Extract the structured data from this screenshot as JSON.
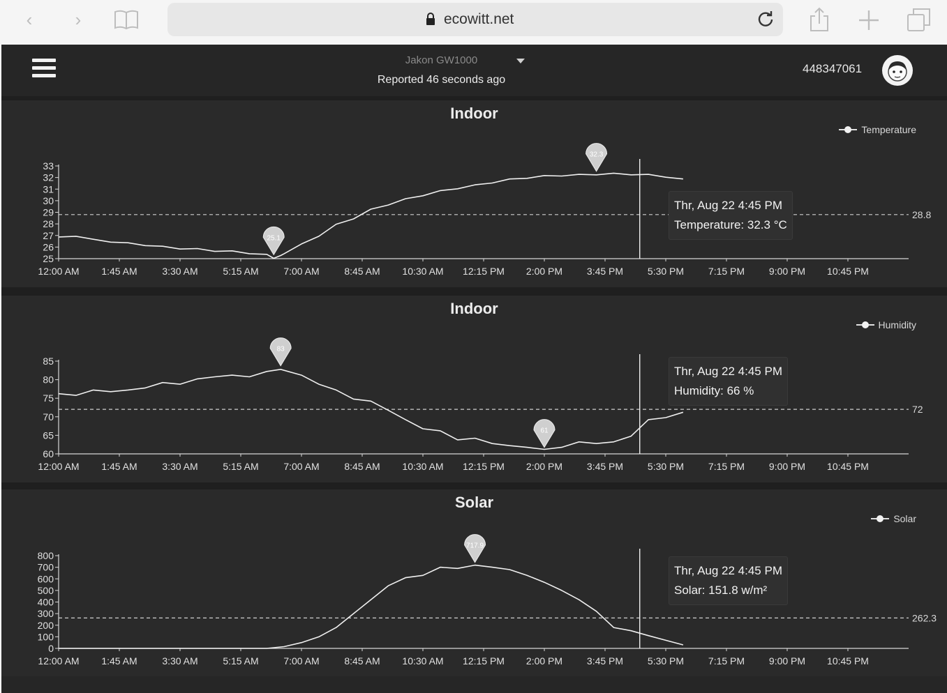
{
  "browser": {
    "url": "ecowitt.net"
  },
  "header": {
    "device": "Jakon GW1000",
    "reported": "Reported 46 seconds ago",
    "user_id": "448347061"
  },
  "charts": [
    {
      "title": "Indoor",
      "legend": "Temperature",
      "avg_label": "28.8",
      "tooltip_time": "Thr, Aug 22 4:45 PM",
      "tooltip_value": "Temperature: 32.3 °C",
      "ymin_label": "25.1",
      "ymax_label": "32.3"
    },
    {
      "title": "Indoor",
      "legend": "Humidity",
      "avg_label": "72",
      "tooltip_time": "Thr, Aug 22 4:45 PM",
      "tooltip_value": "Humidity: 66 %",
      "ymin_label": "61",
      "ymax_label": "83"
    },
    {
      "title": "Solar",
      "legend": "Solar",
      "avg_label": "262.3",
      "tooltip_time": "Thr, Aug 22 4:45 PM",
      "tooltip_value": "Solar: 151.8 w/m²",
      "ymax_label": "717.9"
    }
  ],
  "chart_data": [
    {
      "type": "line",
      "title": "Indoor",
      "legend": "Temperature",
      "x_ticks": [
        "12:00 AM",
        "1:45 AM",
        "3:30 AM",
        "5:15 AM",
        "7:00 AM",
        "8:45 AM",
        "10:30 AM",
        "12:15 PM",
        "2:00 PM",
        "3:45 PM",
        "5:30 PM",
        "7:15 PM",
        "9:00 PM",
        "10:45 PM"
      ],
      "y_ticks": [
        25,
        26,
        27,
        28,
        29,
        30,
        31,
        32,
        33
      ],
      "ylim": [
        25,
        33
      ],
      "xlim_hours": [
        0,
        24.5
      ],
      "average": 28.8,
      "marker_x_hours": 16.75,
      "x_hours": [
        0,
        0.5,
        1,
        1.5,
        2,
        2.5,
        3,
        3.5,
        4,
        4.5,
        5,
        5.5,
        6,
        6.2,
        6.4,
        6.5,
        7,
        7.5,
        8,
        8.5,
        9,
        9.5,
        10,
        10.5,
        11,
        11.5,
        12,
        12.5,
        13,
        13.5,
        14,
        14.5,
        15,
        15.5,
        16,
        16.5,
        17,
        17.5,
        18
      ],
      "y_values": [
        26.8,
        27,
        26.6,
        26.5,
        26.3,
        26.2,
        26,
        25.9,
        25.8,
        25.7,
        25.6,
        25.5,
        25.3,
        25.1,
        25.2,
        25.5,
        26.2,
        27,
        27.9,
        28.5,
        29.2,
        29.7,
        30.1,
        30.5,
        30.8,
        31.1,
        31.3,
        31.6,
        31.8,
        32,
        32.1,
        32.2,
        32.2,
        32.3,
        32.3,
        32.3,
        32.2,
        32.1,
        31.8
      ]
    },
    {
      "type": "line",
      "title": "Indoor",
      "legend": "Humidity",
      "x_ticks": [
        "12:00 AM",
        "1:45 AM",
        "3:30 AM",
        "5:15 AM",
        "7:00 AM",
        "8:45 AM",
        "10:30 AM",
        "12:15 PM",
        "2:00 PM",
        "3:45 PM",
        "5:30 PM",
        "7:15 PM",
        "9:00 PM",
        "10:45 PM"
      ],
      "y_ticks": [
        60,
        65,
        70,
        75,
        80,
        85
      ],
      "ylim": [
        60,
        85
      ],
      "xlim_hours": [
        0,
        24.5
      ],
      "average": 72,
      "marker_x_hours": 16.75,
      "x_hours": [
        0,
        0.5,
        1,
        1.5,
        2,
        2.5,
        3,
        3.5,
        4,
        4.5,
        5,
        5.5,
        6,
        6.4,
        7,
        7.5,
        8,
        8.5,
        9,
        9.5,
        10,
        10.5,
        11,
        11.5,
        12,
        12.5,
        13,
        13.5,
        14,
        14.5,
        15,
        15.5,
        16,
        16.5,
        17,
        17.5,
        18
      ],
      "y_values": [
        76,
        76,
        77,
        77,
        77,
        78,
        79,
        79,
        80,
        81,
        81,
        81,
        82,
        83,
        81,
        79,
        77,
        75,
        74,
        72,
        69,
        67,
        66,
        64,
        64,
        63,
        62,
        62,
        61,
        62,
        63,
        63,
        63,
        65,
        69,
        70,
        71
      ]
    },
    {
      "type": "area",
      "title": "Solar",
      "legend": "Solar",
      "x_ticks": [
        "12:00 AM",
        "1:45 AM",
        "3:30 AM",
        "5:15 AM",
        "7:00 AM",
        "8:45 AM",
        "10:30 AM",
        "12:15 PM",
        "2:00 PM",
        "3:45 PM",
        "5:30 PM",
        "7:15 PM",
        "9:00 PM",
        "10:45 PM"
      ],
      "y_ticks": [
        0,
        100,
        200,
        300,
        400,
        500,
        600,
        700,
        800
      ],
      "ylim": [
        0,
        800
      ],
      "xlim_hours": [
        0,
        24.5
      ],
      "average": 262.3,
      "marker_x_hours": 16.75,
      "x_hours": [
        0,
        6,
        6.5,
        7,
        7.5,
        8,
        8.5,
        9,
        9.5,
        10,
        10.5,
        11,
        11.5,
        12,
        12.5,
        13,
        13.5,
        14,
        14.5,
        15,
        15.5,
        16,
        16.5,
        17,
        17.5,
        18
      ],
      "y_values": [
        0,
        0,
        15,
        50,
        100,
        180,
        300,
        420,
        540,
        610,
        630,
        700,
        690,
        718,
        700,
        680,
        630,
        570,
        500,
        420,
        320,
        180,
        152,
        110,
        70,
        30
      ]
    }
  ]
}
